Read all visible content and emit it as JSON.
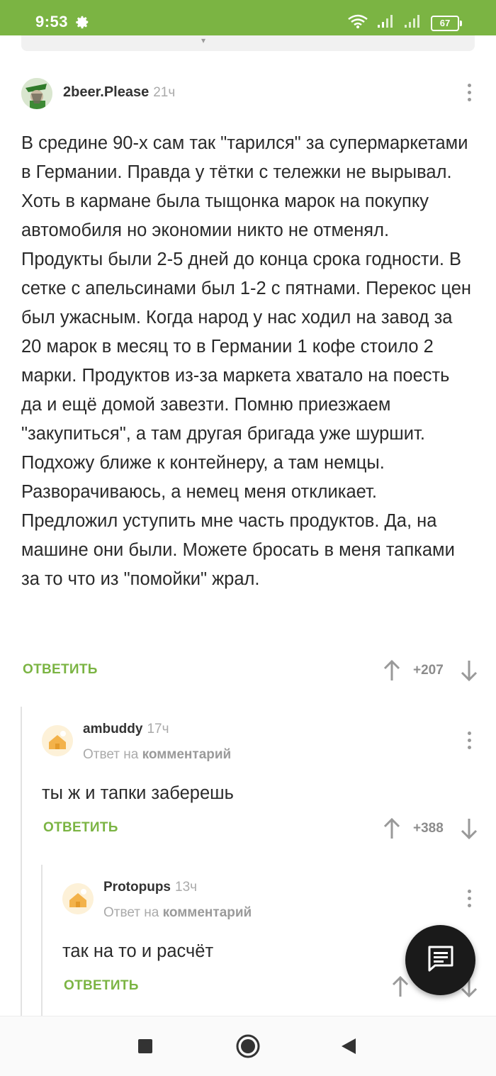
{
  "status_bar": {
    "time": "9:53",
    "battery": "67"
  },
  "colors": {
    "accent": "#7bb443",
    "fab": "#1a1a1a"
  },
  "comments": [
    {
      "author": "2beer.Please",
      "time": "21ч",
      "text": "В средине 90-х сам так \"тарился\" за супермаркетами в Германии. Правда у тётки с тележки не вырывал. Хоть в кармане была тыщонка марок на покупку автомобиля но экономии никто не отменял. Продукты были 2-5 дней до конца срока годности. В сетке с апельсинами был 1-2 с пятнами. Перекос цен был ужасным. Когда народ у нас ходил на завод за 20 марок в месяц то в Германии 1 кофе стоило 2 марки. Продуктов из-за маркета хватало на поесть да и ещё домой завезти. Помню приезжаем \"закупиться\", а там другая бригада уже шуршит. Подхожу ближе к контейнеру, а там немцы. Разворачиваюсь, а немец меня откликает. Предложил уступить мне часть продуктов. Да, на машине они были. Можете бросать в меня тапками за то что из \"помойки\" жрал.",
      "reply_label": "ОТВЕТИТЬ",
      "score": "+207"
    },
    {
      "author": "ambuddy",
      "time": "17ч",
      "reply_to_prefix": "Ответ на",
      "reply_to_link": "комментарий",
      "text": "ты ж и тапки заберешь",
      "reply_label": "ОТВЕТИТЬ",
      "score": "+388"
    },
    {
      "author": "Protopups",
      "time": "13ч",
      "reply_to_prefix": "Ответ на",
      "reply_to_link": "комментарий",
      "text": "так на то и расчёт",
      "reply_label": "ОТВЕТИТЬ"
    }
  ],
  "icons": {
    "fab": "comment-icon",
    "nav": [
      "recents-square-icon",
      "home-circle-icon",
      "back-triangle-icon"
    ]
  }
}
